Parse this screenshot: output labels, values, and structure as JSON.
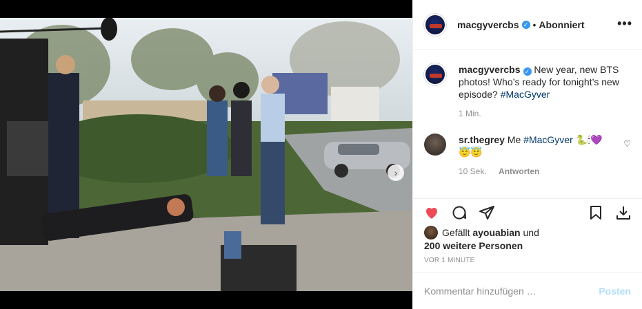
{
  "post": {
    "username": "macgyvercbs",
    "follow_status": "Abonniert",
    "more_icon": "more-horizontal-icon",
    "image_alt": "Behind the scenes photo",
    "carousel_next_icon": "chevron-right-icon",
    "carousel_dots": 3,
    "carousel_active": 0
  },
  "caption": {
    "username": "macgyvercbs",
    "text": "New year, new BTS photos! Who’s ready for tonight’s new episode?",
    "hashtag": "#MacGyver",
    "time": "1 Min."
  },
  "comment": {
    "username": "sr.thegrey",
    "text": "Me",
    "hashtag": "#MacGyver",
    "emojis_line1": "🐍🕯💜",
    "emojis_line2": "😇😇",
    "time": "10 Sek.",
    "reply_label": "Antworten"
  },
  "actions": {
    "like_icon": "heart-filled-icon",
    "comment_icon": "comment-icon",
    "share_icon": "send-icon",
    "save_icon": "bookmark-icon",
    "download_icon": "download-icon",
    "like_color": "#ed4956"
  },
  "likes": {
    "prefix": "Gefällt",
    "user": "ayouabian",
    "and": "und",
    "others": "200 weitere Personen"
  },
  "timestamp": "VOR 1 MINUTE",
  "add_comment": {
    "placeholder": "Kommentar hinzufügen …",
    "post_label": "Posten",
    "post_color": "#b2dffc"
  }
}
